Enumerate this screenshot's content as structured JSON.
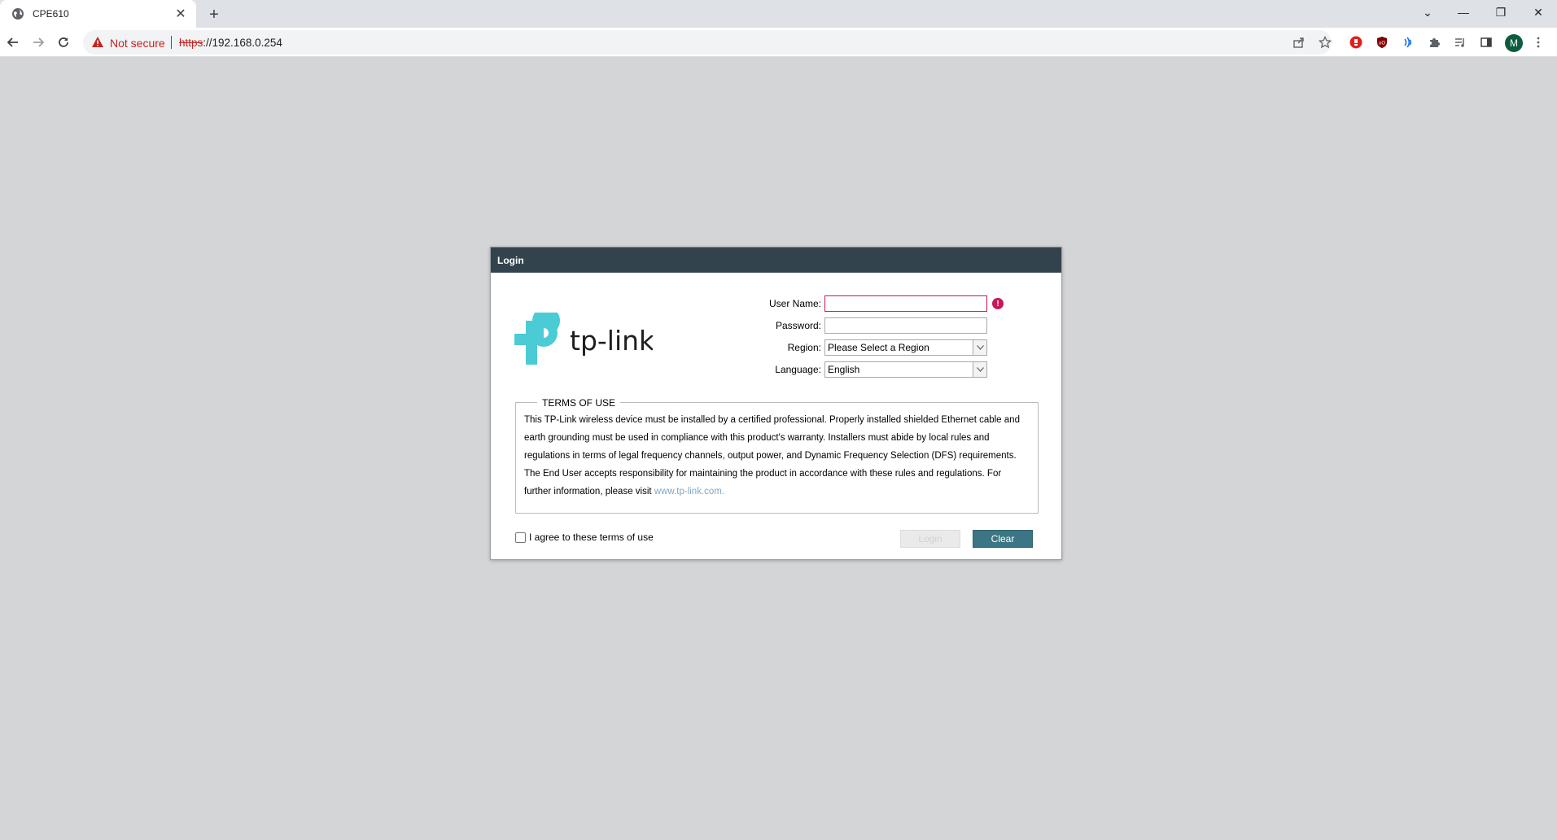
{
  "browser": {
    "tab_title": "CPE610",
    "tab_close": "✕",
    "new_tab": "+",
    "security_label": "Not secure",
    "url_scheme": "https",
    "url_rest": "://192.168.0.254",
    "profile_initial": "M",
    "window_controls": {
      "tabsearch": "⌄",
      "minimize": "—",
      "restore": "❐",
      "close": "✕"
    }
  },
  "dialog": {
    "title": "Login",
    "logo_text": "tp-link",
    "fields": {
      "username_label": "User Name:",
      "username_value": "",
      "password_label": "Password:",
      "password_value": "",
      "region_label": "Region:",
      "region_value": "Please Select a Region",
      "language_label": "Language:",
      "language_value": "English"
    },
    "error_marker": "!",
    "terms": {
      "legend": "TERMS OF USE",
      "body": "This TP-Link wireless device must be installed by a certified professional. Properly installed shielded Ethernet cable and earth grounding must be used in compliance with this product's warranty. Installers must abide by local rules and regulations in terms of legal frequency channels, output power, and Dynamic Frequency Selection (DFS) requirements. The End User accepts responsibility for maintaining the product in accordance with these rules and regulations. For further information, please visit ",
      "link_text": "www.tp-link.com."
    },
    "agree_label": "I agree to these terms of use",
    "agree_checked": false,
    "buttons": {
      "login": "Login",
      "clear": "Clear"
    }
  },
  "colors": {
    "page_bg": "#d4d5d7",
    "dialog_header": "#33434e",
    "brand_teal": "#4acbd6",
    "clear_button": "#3c7684",
    "error": "#c7185b",
    "link": "#7ea8c9"
  }
}
